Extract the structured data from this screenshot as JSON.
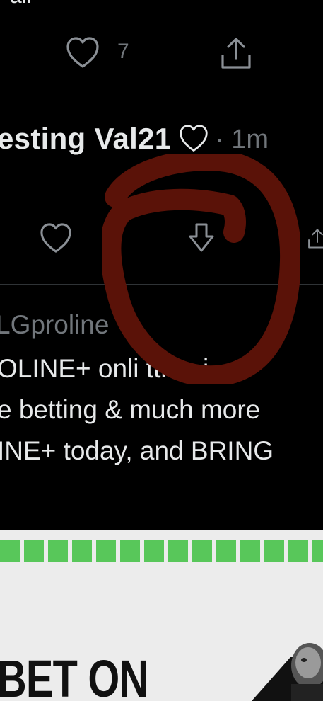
{
  "previous_tweet": {
    "text_fragment": "all",
    "like_count": "7"
  },
  "tweet": {
    "display_name": "esting Val21",
    "separator": "·",
    "timestamp": "1m"
  },
  "promoted_tweet": {
    "handle": "LGproline",
    "body_lines": [
      "OLINE+ onli    tting i",
      "e betting & much more",
      "INE+ today, and BRING"
    ]
  },
  "ad": {
    "headline": "BET ON",
    "accent_color": "#58c75a",
    "strip_count": 14
  },
  "annotation": {
    "shape": "hand-drawn circle",
    "color": "#5a1208"
  },
  "icons": {
    "like": "heart-icon",
    "share": "share-icon",
    "download": "download-arrow-icon"
  }
}
